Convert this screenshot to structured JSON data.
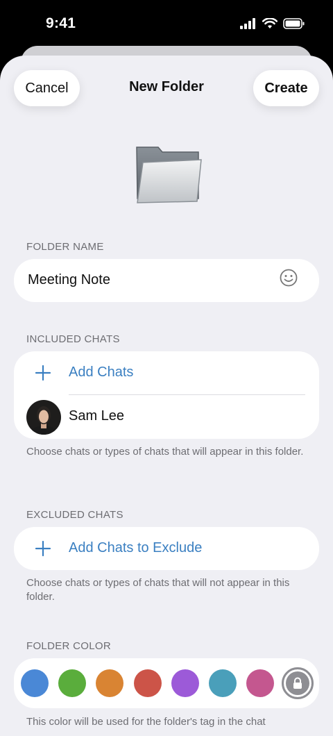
{
  "status": {
    "time": "9:41"
  },
  "nav": {
    "cancel": "Cancel",
    "title": "New Folder",
    "create": "Create"
  },
  "folder_name": {
    "label": "FOLDER NAME",
    "value": "Meeting Note"
  },
  "included": {
    "label": "INCLUDED CHATS",
    "add": "Add Chats",
    "chats": [
      {
        "name": "Sam Lee"
      }
    ],
    "help": "Choose chats or types of chats that will appear in this folder."
  },
  "excluded": {
    "label": "EXCLUDED CHATS",
    "add": "Add Chats to Exclude",
    "help": "Choose chats or types of chats that will not appear in this folder."
  },
  "folder_color": {
    "label": "FOLDER COLOR",
    "colors": [
      "#4a88d6",
      "#5aad3c",
      "#d98433",
      "#cc5448",
      "#9c5ad8",
      "#4a9fba",
      "#c4578f"
    ],
    "help": "This color will be used for the folder's tag in the chat"
  }
}
